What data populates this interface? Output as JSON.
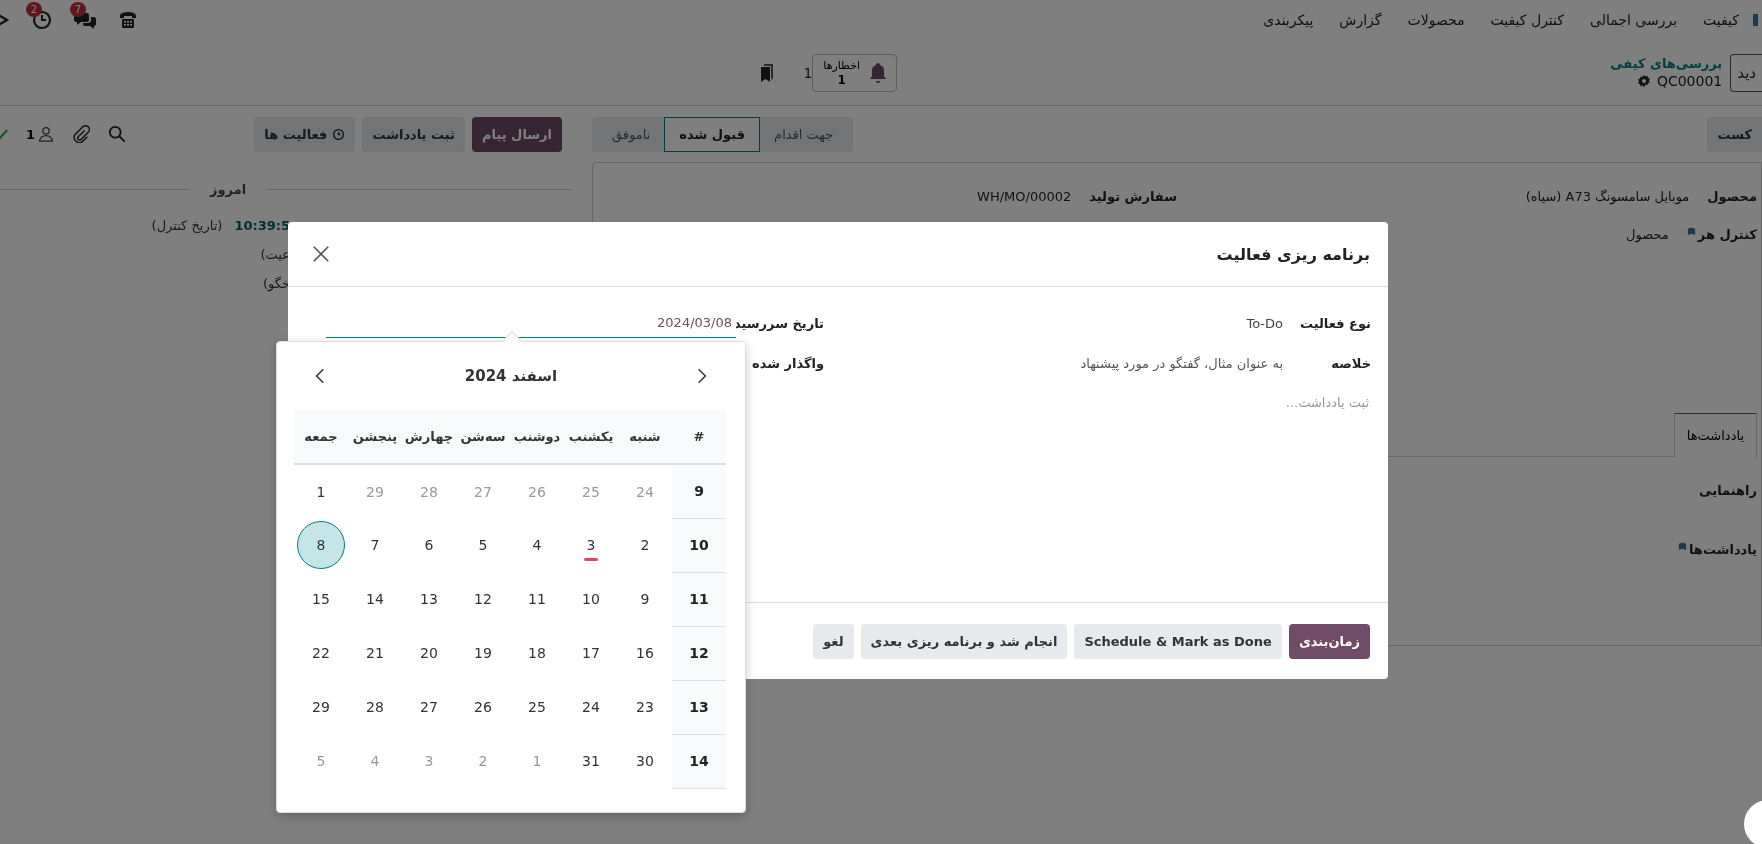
{
  "navbar": {
    "menu_items": [
      "کیفیت",
      "بررسی اجمالی",
      "کنترل کیفیت",
      "محصولات",
      "گزارش",
      "پیکربندی"
    ],
    "systray": [
      {
        "kind": "phone"
      },
      {
        "kind": "chat",
        "badge": "7"
      },
      {
        "kind": "clock",
        "badge": "2"
      },
      {
        "kind": "close"
      }
    ]
  },
  "control_panel": {
    "new_button": "دید",
    "breadcrumb": {
      "parent": "بررسی‌های کیفی",
      "record": "QC00001"
    },
    "alerts": {
      "label": "اخطارها",
      "count": "1"
    },
    "pager": "1"
  },
  "form": {
    "fail_button": "کست",
    "statusbar": [
      {
        "label": "جهت اقدام",
        "selected": false
      },
      {
        "label": "قبول شده",
        "selected": true
      },
      {
        "label": "ناموفق",
        "selected": false
      }
    ],
    "rows": [
      [
        {
          "label": "محصول",
          "value": "موبایل سامسونگ A73 (سیاه)",
          "has_help": false
        },
        {
          "label": "سفارش تولید",
          "value": "WH/MO/00002",
          "has_help": false
        }
      ],
      [
        {
          "label": "کنترل هر",
          "value": "محصول",
          "has_help": true
        }
      ]
    ],
    "tabs": [
      {
        "label": "یادداشت‌ها",
        "selected": true
      }
    ],
    "sections": [
      {
        "label": "راهنمایی",
        "has_help": false
      },
      {
        "label": "یادداشت‌ها",
        "has_help": true
      }
    ]
  },
  "chatter": {
    "buttons": [
      {
        "label": "ارسال پیام",
        "kind": "primary"
      },
      {
        "label": "ثبت یادداشت",
        "kind": "secondary"
      },
      {
        "label": "فعالیت ها",
        "kind": "activity"
      }
    ],
    "followers": "1",
    "date_separator": "امروز",
    "messages": [
      {
        "time": "10:39:5",
        "text": "(تاریخ کنترل)"
      },
      {
        "text": "عیت)"
      },
      {
        "text": "خگو)"
      }
    ]
  },
  "dialog": {
    "title": "برنامه ریزی فعالیت",
    "fields": [
      {
        "label": "نوع فعالیت",
        "value": "To-Do",
        "kind": "value"
      },
      {
        "label": "خلاصه",
        "placeholder": "به عنوان مثال، گفتگو در مورد پیشنهاد",
        "kind": "input"
      }
    ],
    "due_date": {
      "label": "تاریخ سررسید",
      "value": "2024/03/08"
    },
    "assigned_label": "واگذار شده",
    "note_placeholder": "ثبت یادداشت...",
    "buttons": [
      {
        "label": "زمان‌بندی",
        "kind": "primary"
      },
      {
        "label": "Schedule & Mark as Done",
        "kind": "secondary"
      },
      {
        "label": "انجام شد و برنامه ریزی بعدی",
        "kind": "secondary"
      },
      {
        "label": "لغو",
        "kind": "secondary"
      }
    ]
  },
  "datepicker": {
    "title": "اسفند 2024",
    "week_header": "#",
    "weekdays": [
      "شنبه",
      "یکشنب",
      "دوشنب",
      "سه‌شن",
      "چهارش",
      "پنجشن",
      "جمعه"
    ],
    "weeks": [
      {
        "number": "9",
        "days": [
          {
            "label": "24",
            "muted": true,
            "selected": false,
            "today": false
          },
          {
            "label": "25",
            "muted": true,
            "selected": false,
            "today": false
          },
          {
            "label": "26",
            "muted": true,
            "selected": false,
            "today": false
          },
          {
            "label": "27",
            "muted": true,
            "selected": false,
            "today": false
          },
          {
            "label": "28",
            "muted": true,
            "selected": false,
            "today": false
          },
          {
            "label": "29",
            "muted": true,
            "selected": false,
            "today": false
          },
          {
            "label": "1",
            "muted": false,
            "selected": false,
            "today": false
          }
        ]
      },
      {
        "number": "10",
        "days": [
          {
            "label": "2",
            "muted": false,
            "selected": false,
            "today": false
          },
          {
            "label": "3",
            "muted": false,
            "selected": false,
            "today": true
          },
          {
            "label": "4",
            "muted": false,
            "selected": false,
            "today": false
          },
          {
            "label": "5",
            "muted": false,
            "selected": false,
            "today": false
          },
          {
            "label": "6",
            "muted": false,
            "selected": false,
            "today": false
          },
          {
            "label": "7",
            "muted": false,
            "selected": false,
            "today": false
          },
          {
            "label": "8",
            "muted": false,
            "selected": true,
            "today": false
          }
        ]
      },
      {
        "number": "11",
        "days": [
          {
            "label": "9",
            "muted": false,
            "selected": false,
            "today": false
          },
          {
            "label": "10",
            "muted": false,
            "selected": false,
            "today": false
          },
          {
            "label": "11",
            "muted": false,
            "selected": false,
            "today": false
          },
          {
            "label": "12",
            "muted": false,
            "selected": false,
            "today": false
          },
          {
            "label": "13",
            "muted": false,
            "selected": false,
            "today": false
          },
          {
            "label": "14",
            "muted": false,
            "selected": false,
            "today": false
          },
          {
            "label": "15",
            "muted": false,
            "selected": false,
            "today": false
          }
        ]
      },
      {
        "number": "12",
        "days": [
          {
            "label": "16",
            "muted": false,
            "selected": false,
            "today": false
          },
          {
            "label": "17",
            "muted": false,
            "selected": false,
            "today": false
          },
          {
            "label": "18",
            "muted": false,
            "selected": false,
            "today": false
          },
          {
            "label": "19",
            "muted": false,
            "selected": false,
            "today": false
          },
          {
            "label": "20",
            "muted": false,
            "selected": false,
            "today": false
          },
          {
            "label": "21",
            "muted": false,
            "selected": false,
            "today": false
          },
          {
            "label": "22",
            "muted": false,
            "selected": false,
            "today": false
          }
        ]
      },
      {
        "number": "13",
        "days": [
          {
            "label": "23",
            "muted": false,
            "selected": false,
            "today": false
          },
          {
            "label": "24",
            "muted": false,
            "selected": false,
            "today": false
          },
          {
            "label": "25",
            "muted": false,
            "selected": false,
            "today": false
          },
          {
            "label": "26",
            "muted": false,
            "selected": false,
            "today": false
          },
          {
            "label": "27",
            "muted": false,
            "selected": false,
            "today": false
          },
          {
            "label": "28",
            "muted": false,
            "selected": false,
            "today": false
          },
          {
            "label": "29",
            "muted": false,
            "selected": false,
            "today": false
          }
        ]
      },
      {
        "number": "14",
        "days": [
          {
            "label": "30",
            "muted": false,
            "selected": false,
            "today": false
          },
          {
            "label": "31",
            "muted": false,
            "selected": false,
            "today": false
          },
          {
            "label": "1",
            "muted": true,
            "selected": false,
            "today": false
          },
          {
            "label": "2",
            "muted": true,
            "selected": false,
            "today": false
          },
          {
            "label": "3",
            "muted": true,
            "selected": false,
            "today": false
          },
          {
            "label": "4",
            "muted": true,
            "selected": false,
            "today": false
          },
          {
            "label": "5",
            "muted": true,
            "selected": false,
            "today": false
          }
        ]
      }
    ]
  }
}
